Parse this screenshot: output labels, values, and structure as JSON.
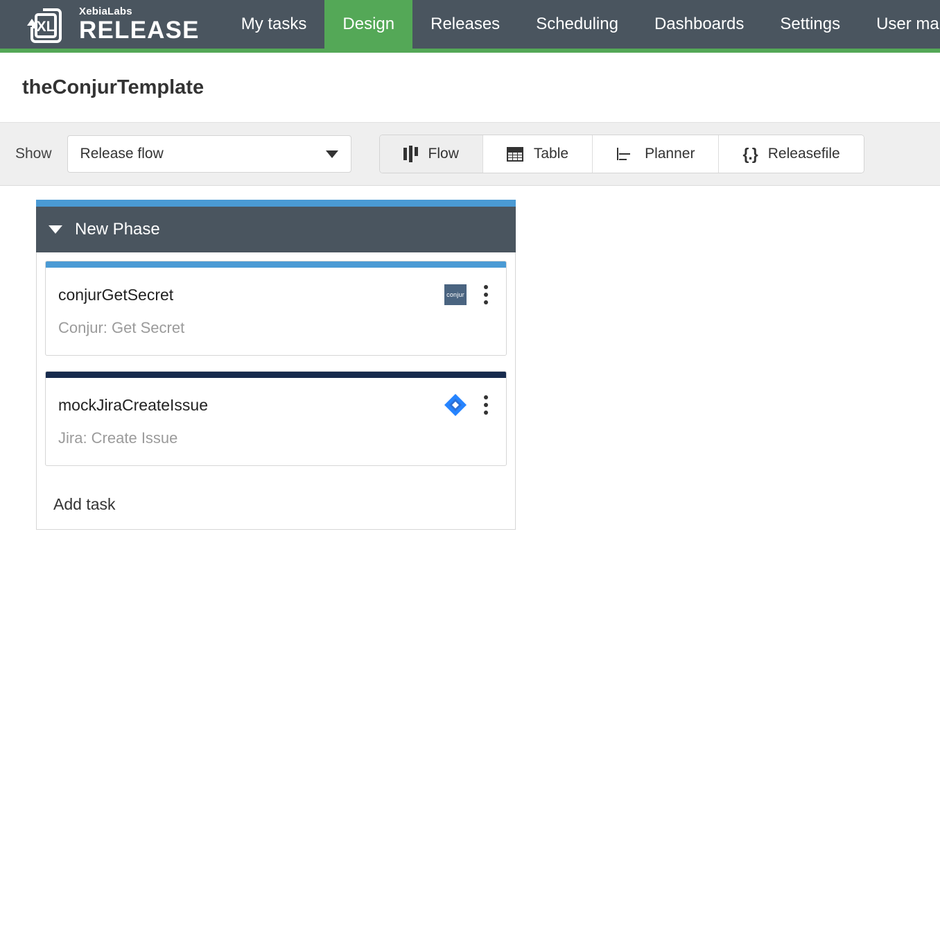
{
  "navbar": {
    "brand": {
      "sub": "XebiaLabs",
      "main": "RELEASE",
      "logo_icon": "xl-release-logo"
    },
    "items": [
      {
        "label": "My tasks",
        "active": false
      },
      {
        "label": "Design",
        "active": true
      },
      {
        "label": "Releases",
        "active": false
      },
      {
        "label": "Scheduling",
        "active": false
      },
      {
        "label": "Dashboards",
        "active": false
      },
      {
        "label": "Settings",
        "active": false
      },
      {
        "label": "User ma",
        "active": false
      }
    ],
    "bg_color": "#4a555f",
    "accent_color": "#54a857"
  },
  "header": {
    "title": "theConjurTemplate"
  },
  "toolbar": {
    "show_label": "Show",
    "select": {
      "value": "Release flow",
      "options": [
        "Release flow"
      ]
    },
    "views": [
      {
        "label": "Flow",
        "icon": "flow-icon",
        "active": true
      },
      {
        "label": "Table",
        "icon": "table-icon",
        "active": false
      },
      {
        "label": "Planner",
        "icon": "planner-icon",
        "active": false
      },
      {
        "label": "Releasefile",
        "icon": "releasefile-icon",
        "glyph": "{.}",
        "active": false
      }
    ]
  },
  "flow": {
    "phase": {
      "name": "New Phase",
      "accent_color": "#4a9ad4",
      "expanded": true,
      "add_task_label": "Add task",
      "tasks": [
        {
          "title": "conjurGetSecret",
          "description": "Conjur: Get Secret",
          "accent_color": "#4a9ad4",
          "icon": "conjur-icon",
          "icon_label": "conjur"
        },
        {
          "title": "mockJiraCreateIssue",
          "description": "Jira: Create Issue",
          "accent_color": "#172b4d",
          "icon": "jira-icon",
          "icon_label": "Jira"
        }
      ]
    }
  }
}
